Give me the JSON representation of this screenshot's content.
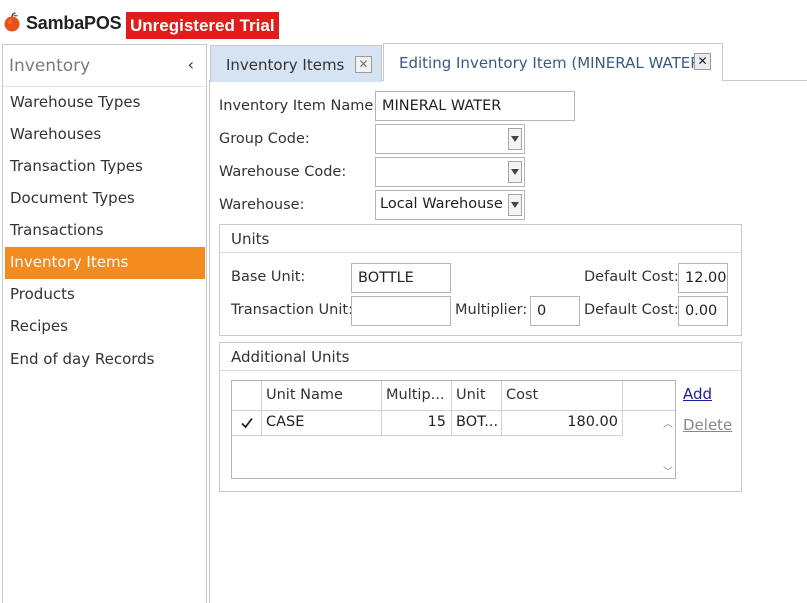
{
  "app": {
    "name": "SambaPOS",
    "trial_badge": "Unregistered Trial"
  },
  "sidebar": {
    "title": "Inventory",
    "collapse_glyph": "‹",
    "items": [
      {
        "label": "Warehouse Types",
        "active": false
      },
      {
        "label": "Warehouses",
        "active": false
      },
      {
        "label": "Transaction Types",
        "active": false
      },
      {
        "label": "Document Types",
        "active": false
      },
      {
        "label": "Transactions",
        "active": false
      },
      {
        "label": "Inventory Items",
        "active": true
      },
      {
        "label": "Products",
        "active": false
      },
      {
        "label": "Recipes",
        "active": false
      },
      {
        "label": "End of day Records",
        "active": false
      }
    ]
  },
  "tabs": [
    {
      "label": "Inventory Items",
      "active": false
    },
    {
      "label": "Editing Inventory Item (MINERAL WATER)",
      "active": true
    }
  ],
  "form": {
    "item_name_label": "Inventory Item Name:",
    "item_name_value": "MINERAL WATER",
    "group_code_label": "Group Code:",
    "group_code_value": "",
    "warehouse_code_label": "Warehouse Code:",
    "warehouse_code_value": "",
    "warehouse_label": "Warehouse:",
    "warehouse_value": "Local Warehouse"
  },
  "units": {
    "title": "Units",
    "base_unit_label": "Base Unit:",
    "base_unit_value": "BOTTLE",
    "default_cost_label": "Default Cost:",
    "default_cost_value": "12.00",
    "transaction_unit_label": "Transaction Unit:",
    "transaction_unit_value": "",
    "multiplier_label": "Multiplier:",
    "multiplier_value": "0",
    "default_cost2_label": "Default Cost:",
    "default_cost2_value": "0.00"
  },
  "additional_units": {
    "title": "Additional Units",
    "columns": [
      "Unit Name",
      "Multip...",
      "Unit",
      "Cost"
    ],
    "rows": [
      {
        "checked": true,
        "unit_name": "CASE",
        "multiplier": "15",
        "unit": "BOT...",
        "cost": "180.00"
      }
    ],
    "add_label": "Add",
    "delete_label": "Delete"
  },
  "colors": {
    "accent": "#f48b1f",
    "trial_badge": "#e21b1b",
    "inactive_tab": "#d6e3f2"
  }
}
